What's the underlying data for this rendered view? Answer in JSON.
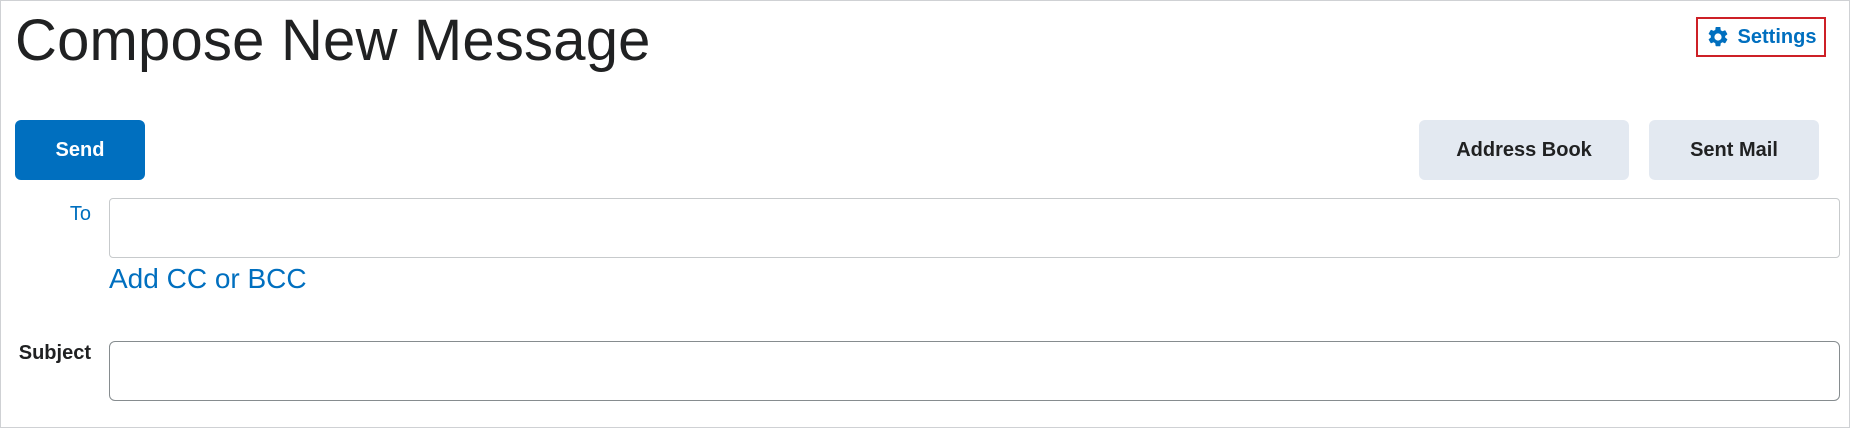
{
  "page": {
    "title": "Compose New Message"
  },
  "header": {
    "settings_label": "Settings",
    "settings_icon": "gear-icon"
  },
  "toolbar": {
    "send_label": "Send",
    "address_book_label": "Address Book",
    "sent_mail_label": "Sent Mail"
  },
  "form": {
    "to_label": "To",
    "to_value": "",
    "add_cc_bcc_label": "Add CC or BCC",
    "subject_label": "Subject",
    "subject_value": ""
  },
  "colors": {
    "accent": "#006fbf",
    "secondary_button": "#e3e9f1",
    "focus_outline": "#cd2026",
    "text": "#202122"
  }
}
